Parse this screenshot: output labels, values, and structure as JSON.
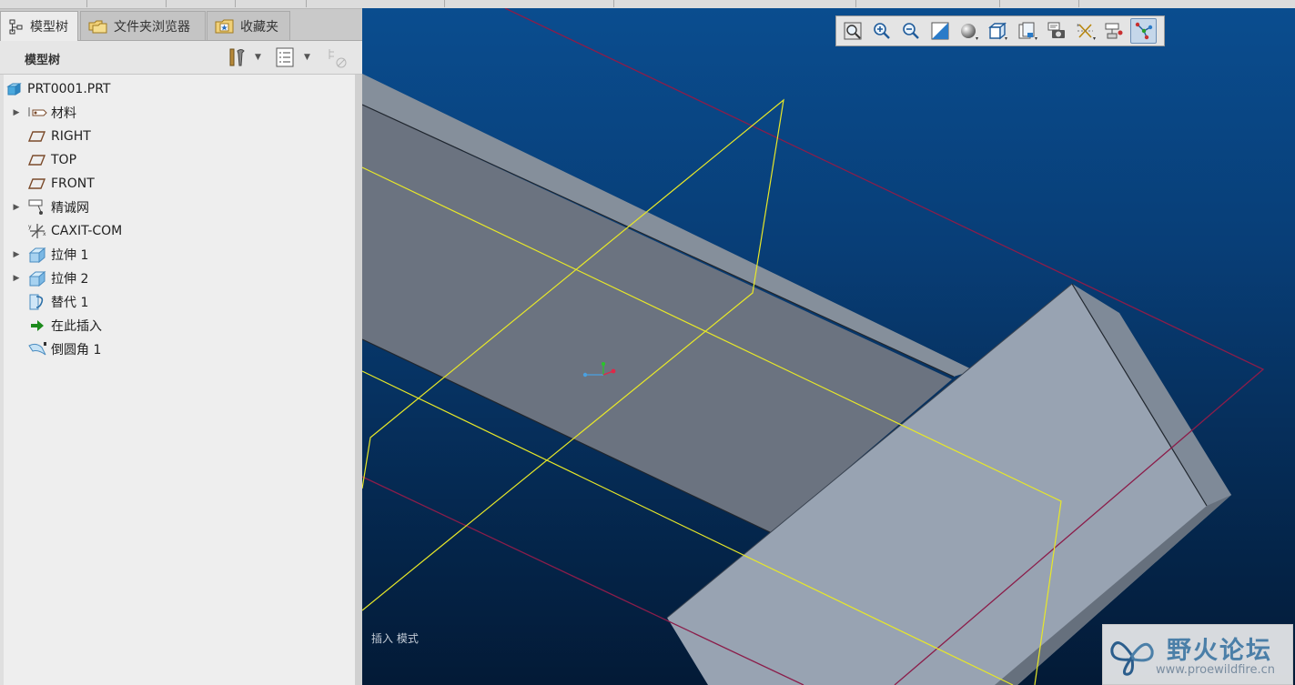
{
  "tabs": [
    {
      "label": "模型树",
      "icon": "model-tree-icon"
    },
    {
      "label": "文件夹浏览器",
      "icon": "folder-browser-icon"
    },
    {
      "label": "收藏夹",
      "icon": "favorites-icon"
    }
  ],
  "tree_header": {
    "title": "模型树"
  },
  "tree": [
    {
      "label": "PRT0001.PRT",
      "icon": "part-icon"
    },
    {
      "label": "材料",
      "icon": "material-icon"
    },
    {
      "label": "RIGHT",
      "icon": "datum-plane-icon"
    },
    {
      "label": "TOP",
      "icon": "datum-plane-icon"
    },
    {
      "label": "FRONT",
      "icon": "datum-plane-icon"
    },
    {
      "label": "精诚网",
      "icon": "annotation-icon"
    },
    {
      "label": "CAXIT-COM",
      "icon": "csys-icon"
    },
    {
      "label": "拉伸 1",
      "icon": "extrude-icon"
    },
    {
      "label": "拉伸 2",
      "icon": "extrude-icon"
    },
    {
      "label": "替代 1",
      "icon": "substitute-icon"
    },
    {
      "label": "在此插入",
      "icon": "insert-here-icon"
    },
    {
      "label": "倒圆角 1",
      "icon": "round-icon"
    }
  ],
  "viewport": {
    "mode_label": "插入 模式",
    "watermark_title": "野火论坛",
    "watermark_url": "www.proewildfire.cn"
  },
  "colors": {
    "viewport_top": "#0a4d8f",
    "viewport_bottom": "#031a36",
    "datum_plane": "#e8e828",
    "datum_frame": "#8b1d4a",
    "solid_face": "#6b7380",
    "solid_top": "#98a3b2"
  }
}
